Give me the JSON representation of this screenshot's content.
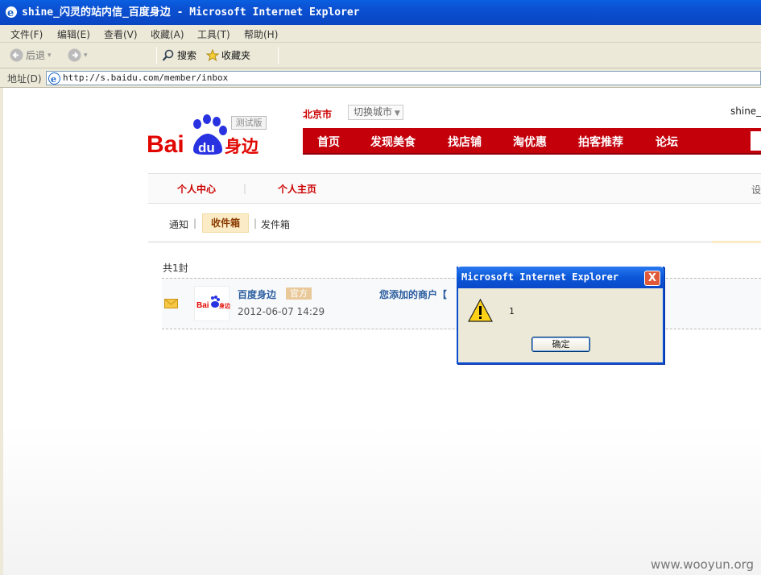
{
  "window": {
    "title": "shine_闪灵的站内信_百度身边 - Microsoft Internet Explorer"
  },
  "menu": [
    "文件(F)",
    "编辑(E)",
    "查看(V)",
    "收藏(A)",
    "工具(T)",
    "帮助(H)"
  ],
  "toolbar": {
    "back": "后退",
    "search": "搜索",
    "favorites": "收藏夹"
  },
  "address": {
    "label": "地址(D)",
    "url": "http://s.baidu.com/member/inbox"
  },
  "header": {
    "city": "北京市",
    "city_switch": "切换城市",
    "username": "shine_",
    "logo_badge": "测试版",
    "logo_text_bai": "Bai",
    "logo_text_du": "du",
    "logo_text_cn": "身边"
  },
  "nav": [
    "首页",
    "发现美食",
    "找店铺",
    "淘优惠",
    "拍客推荐",
    "论坛"
  ],
  "tabs": {
    "personal": "个人中心",
    "homepage": "个人主页",
    "divider": "|",
    "settings": "设"
  },
  "subtabs": {
    "notice": "通知",
    "inbox": "收件箱",
    "outbox": "发件箱",
    "sep": "|"
  },
  "inbox": {
    "count": "共1封",
    "sender": "百度身边",
    "official_badge": "官方",
    "time": "2012-06-07 14:29",
    "subject": "您添加的商户【"
  },
  "dialog": {
    "title": "Microsoft Internet Explorer",
    "message": "1",
    "ok": "确定",
    "close": "X"
  },
  "watermark": "www.wooyun.org",
  "colors": {
    "brand_red": "#c4000b",
    "xp_blue": "#0b4fd0",
    "dialog_bg": "#ece9d8"
  }
}
